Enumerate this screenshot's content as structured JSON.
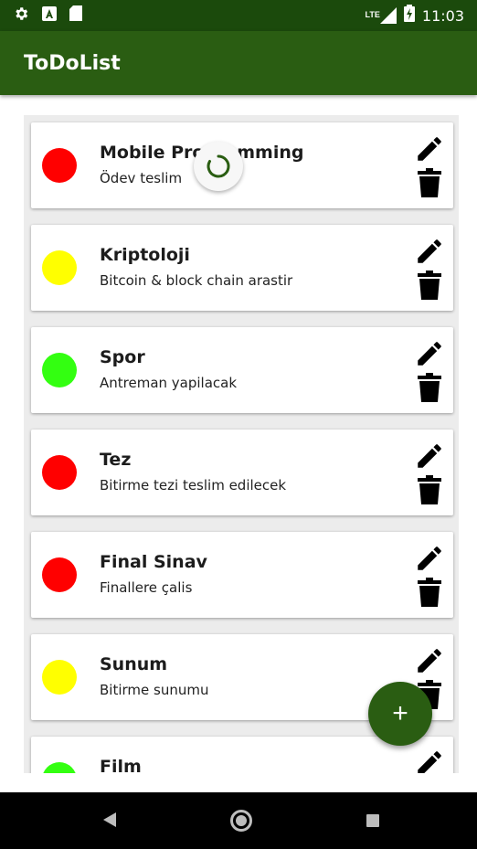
{
  "status_bar": {
    "time": "11:03",
    "network": "LTE",
    "icons": [
      "settings-icon",
      "a-notification-icon",
      "sd-card-icon",
      "signal-icon",
      "battery-charging-icon"
    ]
  },
  "app_bar": {
    "title": "ToDoList"
  },
  "tasks": [
    {
      "title": "Mobile Programming",
      "subtitle": "Ödev teslim",
      "priority_color": "#ff0000"
    },
    {
      "title": "Kriptoloji",
      "subtitle": "Bitcoin & block chain arastir",
      "priority_color": "#ffff00"
    },
    {
      "title": "Spor",
      "subtitle": "Antreman yapilacak",
      "priority_color": "#33ff11"
    },
    {
      "title": "Tez",
      "subtitle": "Bitirme tezi teslim edilecek",
      "priority_color": "#ff0000"
    },
    {
      "title": "Final Sinav",
      "subtitle": "Finallere çalis",
      "priority_color": "#ff0000"
    },
    {
      "title": "Sunum",
      "subtitle": "Bitirme sunumu",
      "priority_color": "#ffff00"
    },
    {
      "title": "Film",
      "subtitle": "",
      "priority_color": "#33ff11"
    }
  ],
  "fab": {
    "label": "+"
  },
  "colors": {
    "status_bar": "#1b4a0c",
    "app_bar": "#2a5d12",
    "fab": "#2a5d12"
  }
}
